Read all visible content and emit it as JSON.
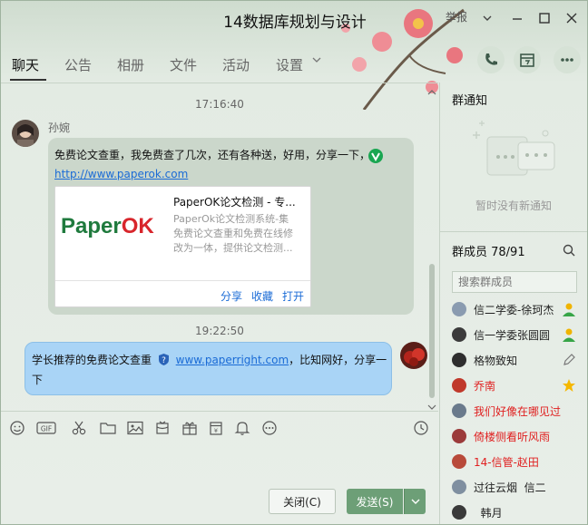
{
  "window": {
    "title": "14数据库规划与设计",
    "report_label": "举报"
  },
  "tabs": [
    {
      "label": "聊天"
    },
    {
      "label": "公告"
    },
    {
      "label": "相册"
    },
    {
      "label": "文件"
    },
    {
      "label": "活动"
    },
    {
      "label": "设置"
    }
  ],
  "chat": {
    "time1": "17:16:40",
    "msg1": {
      "sender": "孙婉",
      "text": "免费论文查重，我免费查了几次，还有各种送，好用，分享一下，",
      "link": "http://www.paperok.com",
      "card": {
        "logo": "PaperOK",
        "title": "PaperOK论文检测 - 专...",
        "desc_line1": "PaperOk论文检测系统-集",
        "desc_line2": "免费论文查重和免费在线修",
        "desc_line3": "改为一体，提供论文检测...",
        "share": "分享",
        "collect": "收藏",
        "open": "打开"
      }
    },
    "time2": "19:22:50",
    "msg2": {
      "text_before": "学长推荐的免费论文查重",
      "link": "www.paperright.com",
      "text_after": "，比知网好，分享一",
      "text_line2": "下"
    }
  },
  "buttons": {
    "close": "关闭(C)",
    "send": "发送(S)"
  },
  "notice": {
    "title": "群通知",
    "empty": "暂时没有新通知"
  },
  "members": {
    "title": "群成员 78/91",
    "search_placeholder": "搜索群成员",
    "list": [
      {
        "name": "信二学委-徐珂杰",
        "color": "#222"
      },
      {
        "name": "信一学委张圆圆",
        "color": "#222"
      },
      {
        "name": "格物致知",
        "color": "#222"
      },
      {
        "name": "乔南",
        "color": "#e02020"
      },
      {
        "name": "我们好像在哪见过",
        "color": "#e02020"
      },
      {
        "name": "倚楼侧看听风雨",
        "color": "#e02020"
      },
      {
        "name": "14-信管-赵田",
        "color": "#e02020"
      },
      {
        "name": "过往云烟  信二",
        "color": "#222"
      },
      {
        "name": "  韩月",
        "color": "#222"
      }
    ]
  }
}
